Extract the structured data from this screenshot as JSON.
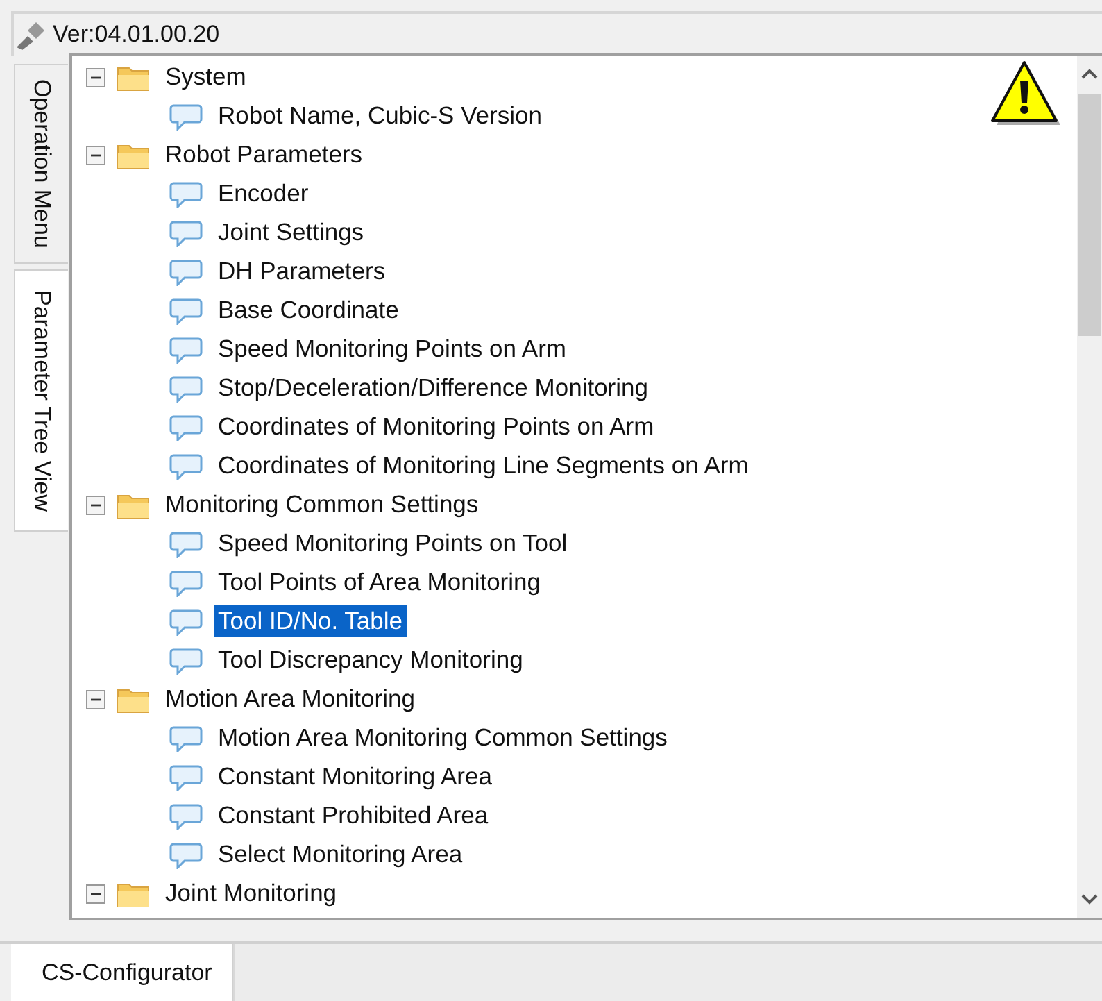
{
  "header": {
    "version": "Ver:04.01.00.20"
  },
  "side_tabs": [
    {
      "label": "Operation Menu",
      "selected": false
    },
    {
      "label": "Parameter Tree View",
      "selected": true
    }
  ],
  "tree": [
    {
      "label": "System",
      "kind": "folder",
      "expanded": true,
      "children": [
        {
          "label": "Robot Name, Cubic-S Version",
          "kind": "item",
          "selected": false
        }
      ]
    },
    {
      "label": "Robot Parameters",
      "kind": "folder",
      "expanded": true,
      "children": [
        {
          "label": "Encoder",
          "kind": "item",
          "selected": false
        },
        {
          "label": "Joint Settings",
          "kind": "item",
          "selected": false
        },
        {
          "label": "DH Parameters",
          "kind": "item",
          "selected": false
        },
        {
          "label": "Base Coordinate",
          "kind": "item",
          "selected": false
        },
        {
          "label": "Speed Monitoring Points on Arm",
          "kind": "item",
          "selected": false
        },
        {
          "label": "Stop/Deceleration/Difference Monitoring",
          "kind": "item",
          "selected": false
        },
        {
          "label": "Coordinates of Monitoring Points on Arm",
          "kind": "item",
          "selected": false
        },
        {
          "label": "Coordinates of Monitoring Line Segments on Arm",
          "kind": "item",
          "selected": false
        }
      ]
    },
    {
      "label": "Monitoring Common Settings",
      "kind": "folder",
      "expanded": true,
      "children": [
        {
          "label": "Speed Monitoring Points on Tool",
          "kind": "item",
          "selected": false
        },
        {
          "label": "Tool Points of Area Monitoring",
          "kind": "item",
          "selected": false
        },
        {
          "label": "Tool ID/No. Table",
          "kind": "item",
          "selected": true
        },
        {
          "label": "Tool Discrepancy Monitoring",
          "kind": "item",
          "selected": false
        }
      ]
    },
    {
      "label": "Motion Area Monitoring",
      "kind": "folder",
      "expanded": true,
      "children": [
        {
          "label": "Motion Area Monitoring Common Settings",
          "kind": "item",
          "selected": false
        },
        {
          "label": "Constant Monitoring Area",
          "kind": "item",
          "selected": false
        },
        {
          "label": "Constant Prohibited Area",
          "kind": "item",
          "selected": false
        },
        {
          "label": "Select Monitoring Area",
          "kind": "item",
          "selected": false
        }
      ]
    },
    {
      "label": "Joint Monitoring",
      "kind": "folder",
      "expanded": true
    }
  ],
  "bottom_tabs": [
    {
      "label": "CS-Configurator",
      "selected": true
    }
  ]
}
